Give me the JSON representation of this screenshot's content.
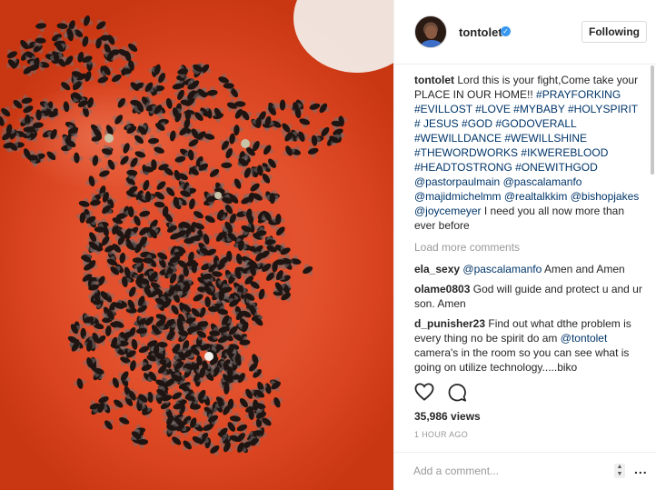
{
  "post": {
    "username": "tontolet",
    "follow_label": "Following",
    "caption_text": "Lord this is your fight,Come take your PLACE IN OUR HOME!!",
    "caption_tags": "#PRAYFORKING #EVILLOST #LOVE #MYBABY #HOLYSPIRIT # JESUS #GOD #GODOVERALL #WEWILLDANCE #WEWILLSHINE #THEWORDWORKS #IKWEREBLOOD #HEADTOSTRONG #ONEWITHGOD @pastorpaulmain @pascalamanfo @majidmichelmm @realtalkkim @bishopjakes @joycemeyer",
    "caption_tail": "I need you all now more than ever before"
  },
  "comments_section": {
    "load_more": "Load more comments",
    "items": [
      {
        "user": "ela_sexy",
        "mention": "@pascalamanfo",
        "text": "Amen and Amen"
      },
      {
        "user": "olame0803",
        "text": "God will guide and protect u and ur son. Amen"
      },
      {
        "user": "d_punisher23",
        "text": "Find out what dthe problem is every thing no be spirit do am",
        "mention": "@tontolet",
        "text2": "camera's in the room so you can see what is going on utilize technology.....biko"
      }
    ]
  },
  "stats": {
    "views": "35,986 views",
    "time": "1 HOUR AGO"
  },
  "add_comment": {
    "placeholder": "Add a comment...",
    "more": "..."
  },
  "icons": {
    "like": "heart-icon",
    "comment": "comment-icon",
    "verified": "verified-badge-icon",
    "more": "more-options-icon"
  },
  "colors": {
    "link": "#003569",
    "verified": "#3897f0",
    "photo_base": "#e3522e"
  }
}
